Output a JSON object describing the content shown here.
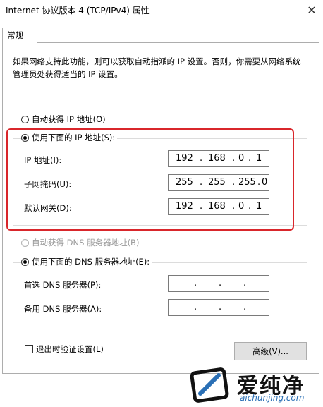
{
  "window": {
    "title": "Internet 协议版本 4 (TCP/IPv4) 属性",
    "close_icon": "close-icon"
  },
  "tabs": [
    {
      "label": "常规"
    }
  ],
  "description": "如果网络支持此功能，则可以获取自动指派的 IP 设置。否则，你需要从网络系统管理员处获得适当的 IP 设置。",
  "ip_section": {
    "auto_option": "自动获得 IP 地址(O)",
    "manual_option": "使用下面的 IP 地址(S):",
    "ip_label": "IP 地址(I):",
    "mask_label": "子网掩码(U):",
    "gateway_label": "默认网关(D):",
    "ip": [
      "192",
      "168",
      "0",
      "1"
    ],
    "mask": [
      "255",
      "255",
      "255",
      "0"
    ],
    "gateway": [
      "192",
      "168",
      "0",
      "1"
    ]
  },
  "dns_section": {
    "auto_option": "自动获得 DNS 服务器地址(B)",
    "manual_option": "使用下面的 DNS 服务器地址(E):",
    "preferred_label": "首选 DNS 服务器(P):",
    "alternate_label": "备用 DNS 服务器(A):",
    "dot": "."
  },
  "validate_label": "退出时验证设置(L)",
  "advanced_button": "高级(V)...",
  "watermark": {
    "brand": "爱纯净",
    "url": "aichunjing.com"
  },
  "colors": {
    "highlight_border": "#d9262b",
    "watermark_url": "#2a6fb5"
  }
}
